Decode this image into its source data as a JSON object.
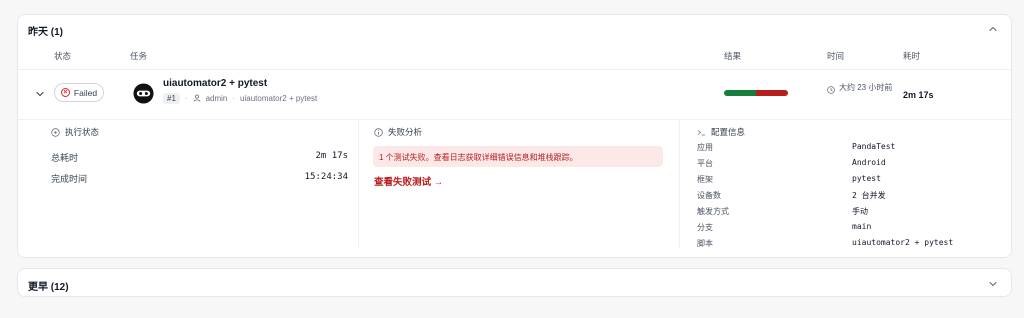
{
  "groups": [
    {
      "title": "昨天 (1)",
      "expanded": true
    },
    {
      "title": "更早 (12)",
      "expanded": false
    }
  ],
  "columns": {
    "status": "状态",
    "task": "任务",
    "result": "结果",
    "time": "时间",
    "duration": "耗时"
  },
  "run": {
    "status": "Failed",
    "title": "uiautomator2 + pytest",
    "number": "#1",
    "user": "admin",
    "script": "uiautomator2 + pytest",
    "result": {
      "passed_fraction": 0.5,
      "failed_fraction": 0.5,
      "pass_color": "#15803d",
      "fail_color": "#b91c1c"
    },
    "time": "大约 23 小时前",
    "duration": "2m 17s"
  },
  "execution": {
    "heading": "执行状态",
    "rows": [
      {
        "label": "总耗时",
        "value": "2m 17s"
      },
      {
        "label": "完成时间",
        "value": "15:24:34"
      }
    ]
  },
  "failure": {
    "heading": "失败分析",
    "message": "1 个测试失败。查看日志获取详细错误信息和堆栈跟踪。",
    "link": "查看失败测试 →"
  },
  "config": {
    "heading": "配置信息",
    "rows": [
      {
        "label": "应用",
        "value": "PandaTest"
      },
      {
        "label": "平台",
        "value": "Android"
      },
      {
        "label": "框架",
        "value": "pytest"
      },
      {
        "label": "设备数",
        "value": "2 台并发"
      },
      {
        "label": "触发方式",
        "value": "手动"
      },
      {
        "label": "分支",
        "value": "main"
      },
      {
        "label": "脚本",
        "value": "uiautomator2 + pytest"
      }
    ]
  },
  "icons": {
    "collapse": "chevron-up-icon",
    "expand": "chevron-down-icon",
    "status": "x-circle-icon",
    "user": "user-icon",
    "clock": "clock-icon",
    "execution": "activity-icon",
    "failure": "info-icon",
    "config": "terminal-icon"
  }
}
